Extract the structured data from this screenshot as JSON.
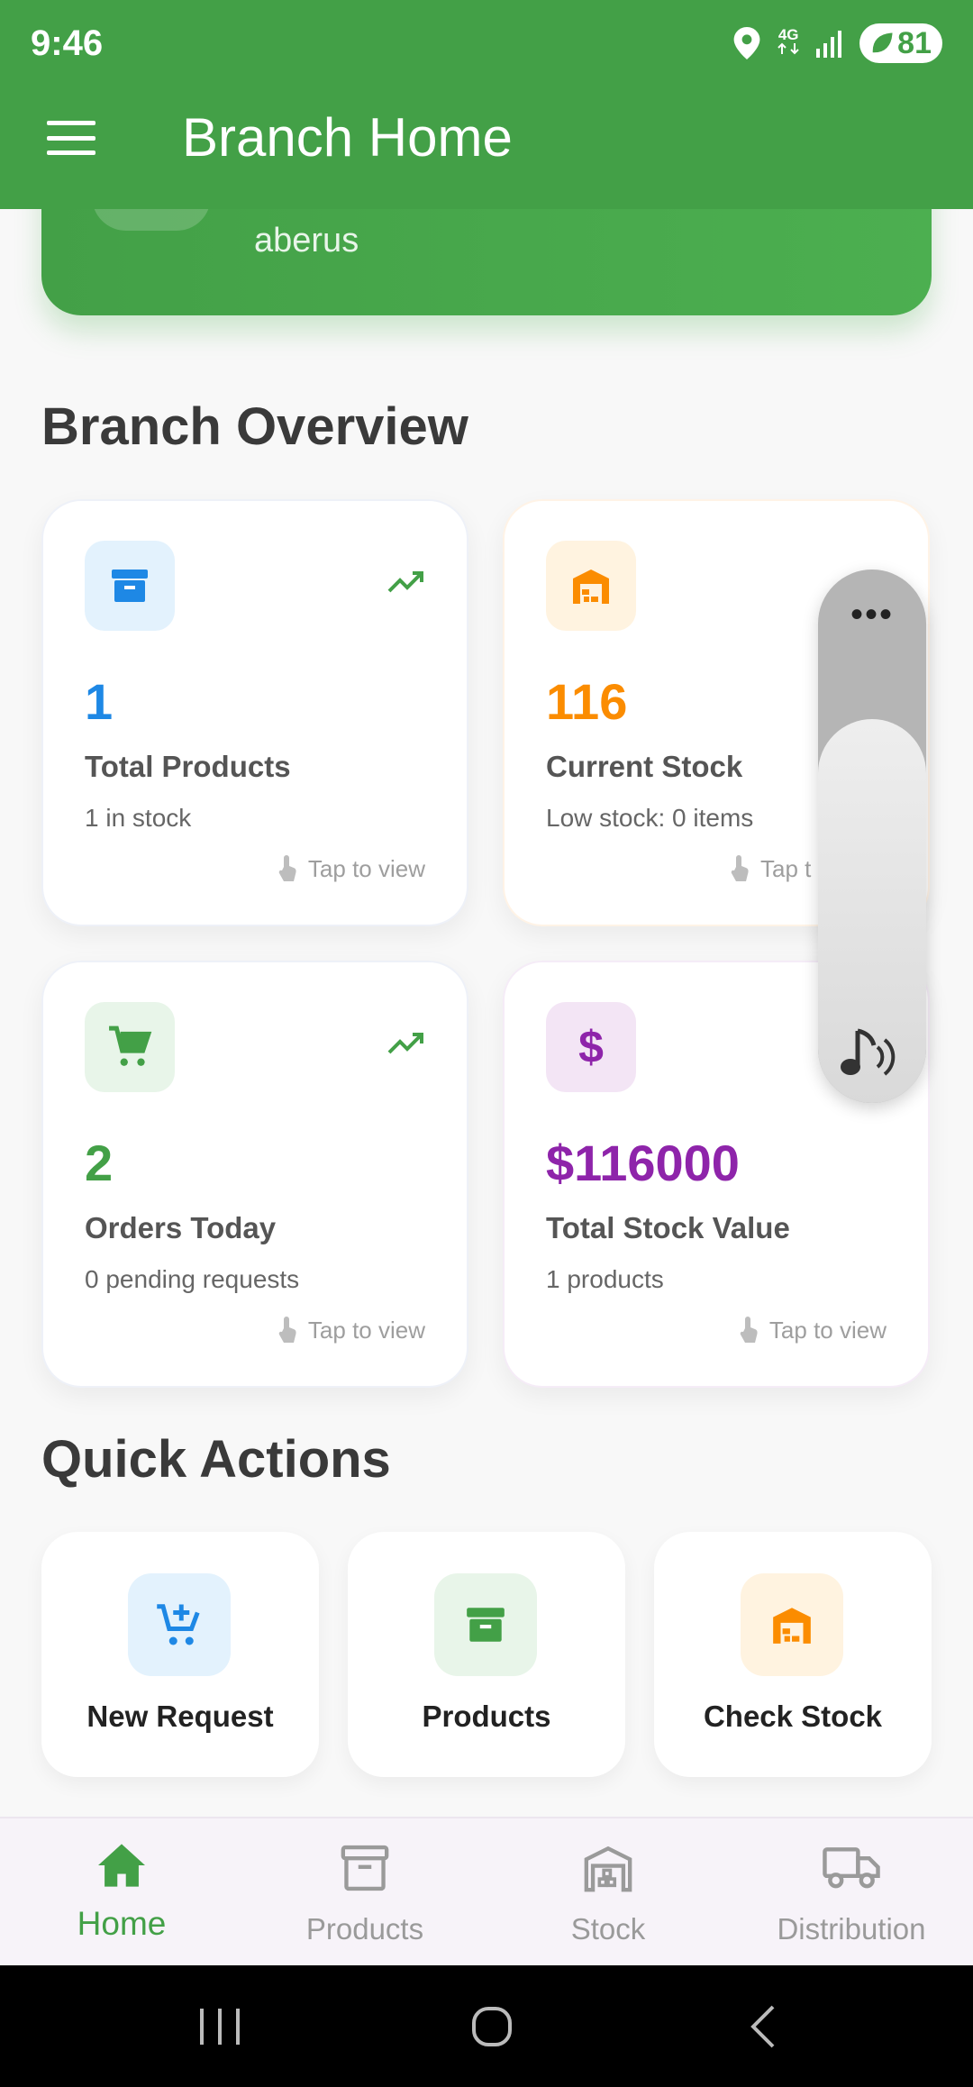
{
  "status_bar": {
    "time": "9:46",
    "network": "4G",
    "battery": "81"
  },
  "app_bar": {
    "title": "Branch Home"
  },
  "banner": {
    "branch_name": "aberus"
  },
  "overview": {
    "title": "Branch Overview",
    "cards": [
      {
        "value": "1",
        "label": "Total Products",
        "sub": "1 in stock",
        "hint": "Tap to view",
        "color": "#1e88e5",
        "icon": "archive-icon"
      },
      {
        "value": "116",
        "label": "Current Stock",
        "sub": "Low stock: 0 items",
        "hint": "Tap t",
        "color": "#fb8c00",
        "icon": "warehouse-icon"
      },
      {
        "value": "2",
        "label": "Orders Today",
        "sub": "0 pending requests",
        "hint": "Tap to view",
        "color": "#43a047",
        "icon": "cart-icon"
      },
      {
        "value": "$116000",
        "label": "Total Stock Value",
        "sub": "1 products",
        "hint": "Tap to view",
        "color": "#8e24aa",
        "icon": "dollar-icon"
      }
    ]
  },
  "quick_actions": {
    "title": "Quick Actions",
    "items": [
      {
        "label": "New Request",
        "icon": "add-cart-icon"
      },
      {
        "label": "Products",
        "icon": "archive-icon"
      },
      {
        "label": "Check Stock",
        "icon": "warehouse-icon"
      }
    ]
  },
  "bottom_nav": {
    "items": [
      {
        "label": "Home",
        "icon": "home-icon",
        "active": true
      },
      {
        "label": "Products",
        "icon": "archive-icon",
        "active": false
      },
      {
        "label": "Stock",
        "icon": "warehouse-icon",
        "active": false
      },
      {
        "label": "Distribution",
        "icon": "truck-icon",
        "active": false
      }
    ]
  },
  "volume_panel": {
    "level_fraction": 0.72,
    "icon": "music-volume-icon"
  },
  "colors": {
    "primary": "#43a047",
    "blue": "#1e88e5",
    "orange": "#fb8c00",
    "purple": "#8e24aa"
  }
}
